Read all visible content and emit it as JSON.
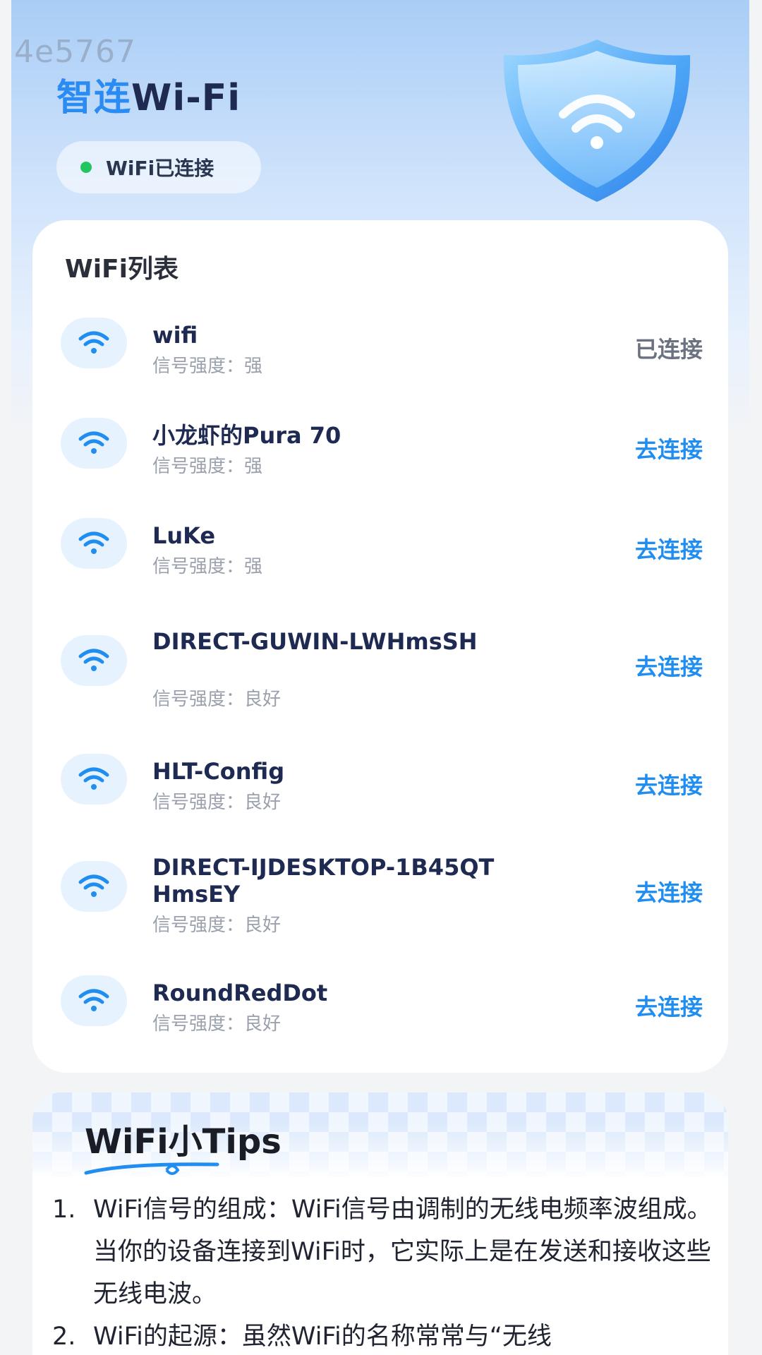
{
  "watermark": "4e5767",
  "header": {
    "title_part1": "智连",
    "title_part2": "Wi-Fi",
    "status_text": "WiFi已连接"
  },
  "colors": {
    "accent": "#1f8ef0",
    "status_green": "#22c55e",
    "title_dark": "#1e2a52"
  },
  "wifi_list": {
    "title": "WiFi列表",
    "items": [
      {
        "ssid": "wifi",
        "signal": "信号强度：强",
        "action": "已连接",
        "icon": "wifi-icon"
      },
      {
        "ssid": "小龙虾的Pura 70",
        "signal": "信号强度：强",
        "action": "去连接",
        "icon": "wifi-icon"
      },
      {
        "ssid": "LuKe",
        "signal": "信号强度：强",
        "action": "去连接",
        "icon": "wifi-icon"
      },
      {
        "ssid": "DIRECT-GUWIN-LWHmsSH",
        "signal": "信号强度：良好",
        "action": "去连接",
        "icon": "wifi-icon"
      },
      {
        "ssid": "HLT-Config",
        "signal": "信号强度：良好",
        "action": "去连接",
        "icon": "wifi-icon"
      },
      {
        "ssid": "DIRECT-IJDESKTOP-1B45QTHmsEY",
        "signal": "信号强度：良好",
        "action": "去连接",
        "icon": "wifi-icon"
      },
      {
        "ssid": "RoundRedDot",
        "signal": "信号强度：良好",
        "action": "去连接",
        "icon": "wifi-icon"
      }
    ]
  },
  "tips": {
    "title": "WiFi小Tips",
    "items": [
      {
        "num": "1.",
        "text": "WiFi信号的组成：WiFi信号由调制的无线电频率波组成。当你的设备连接到WiFi时，它实际上是在发送和接收这些无线电波。"
      },
      {
        "num": "2.",
        "text": "WiFi的起源：虽然WiFi的名称常常与“无线"
      }
    ]
  }
}
